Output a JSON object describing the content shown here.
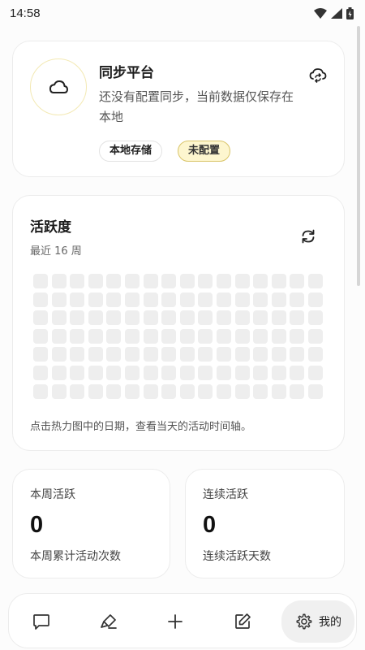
{
  "status_bar": {
    "time": "14:58",
    "icons": [
      "wifi-icon",
      "signal-icon",
      "battery-icon"
    ]
  },
  "sync_card": {
    "icon": "cloud-icon",
    "title": "同步平台",
    "description": "还没有配置同步，当前数据仅保存在本地",
    "action_icon": "cloud-sync-icon",
    "chips": {
      "local": "本地存储",
      "status": "未配置"
    }
  },
  "activity_card": {
    "title": "活跃度",
    "subtitle": "最近 16 周",
    "refresh_icon": "refresh-icon",
    "heatmap": {
      "weeks": 16,
      "days": 7,
      "cell_color": "#eeeeee"
    },
    "hint": "点击热力图中的日期，查看当天的活动时间轴。"
  },
  "stats": {
    "week": {
      "label": "本周活跃",
      "value": "0",
      "desc": "本周累计活动次数"
    },
    "streak": {
      "label": "连续活跃",
      "value": "0",
      "desc": "连续活跃天数"
    }
  },
  "bottom_nav": {
    "items": [
      "chat-icon",
      "highlight-icon",
      "add-icon",
      "edit-icon"
    ],
    "profile_label": "我的",
    "profile_icon": "gear-icon"
  },
  "colors": {
    "accent_yellow": "#fdf6cf",
    "accent_border": "#d9c469",
    "card_bg": "#ffffff"
  }
}
